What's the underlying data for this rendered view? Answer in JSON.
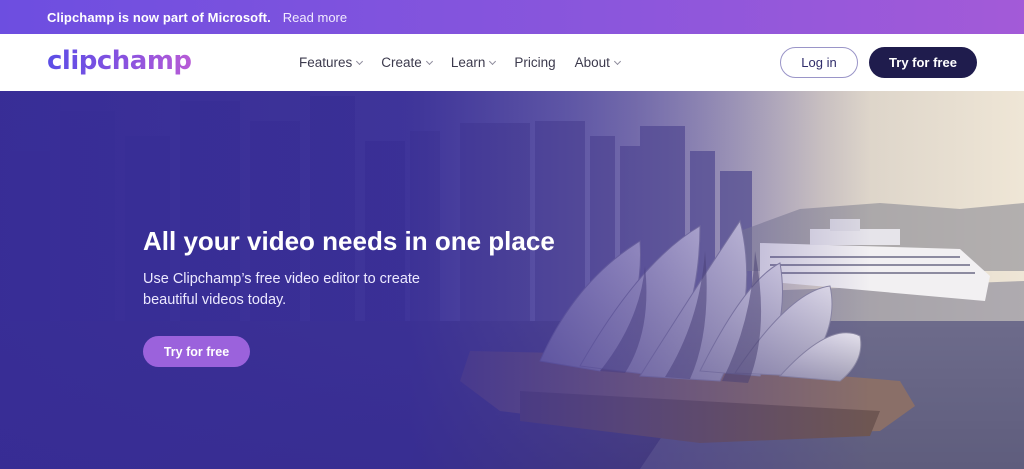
{
  "banner": {
    "text": "Clipchamp is now part of Microsoft.",
    "link": "Read more"
  },
  "nav": {
    "logo": "clipchamp",
    "menu": [
      {
        "label": "Features",
        "has_dropdown": true
      },
      {
        "label": "Create",
        "has_dropdown": true
      },
      {
        "label": "Learn",
        "has_dropdown": true
      },
      {
        "label": "Pricing",
        "has_dropdown": false
      },
      {
        "label": "About",
        "has_dropdown": true
      }
    ],
    "login_label": "Log in",
    "try_label": "Try for free"
  },
  "hero": {
    "title": "All your video needs in one place",
    "subtitle": "Use Clipchamp’s free video editor to create beautiful videos today.",
    "cta_label": "Try for free"
  },
  "colors": {
    "banner_start": "#6d4ee0",
    "banner_end": "#a35ad8",
    "nav_cta": "#1f1c4d",
    "hero_cta": "#9b62dc",
    "hero_overlay": "#372c96"
  }
}
